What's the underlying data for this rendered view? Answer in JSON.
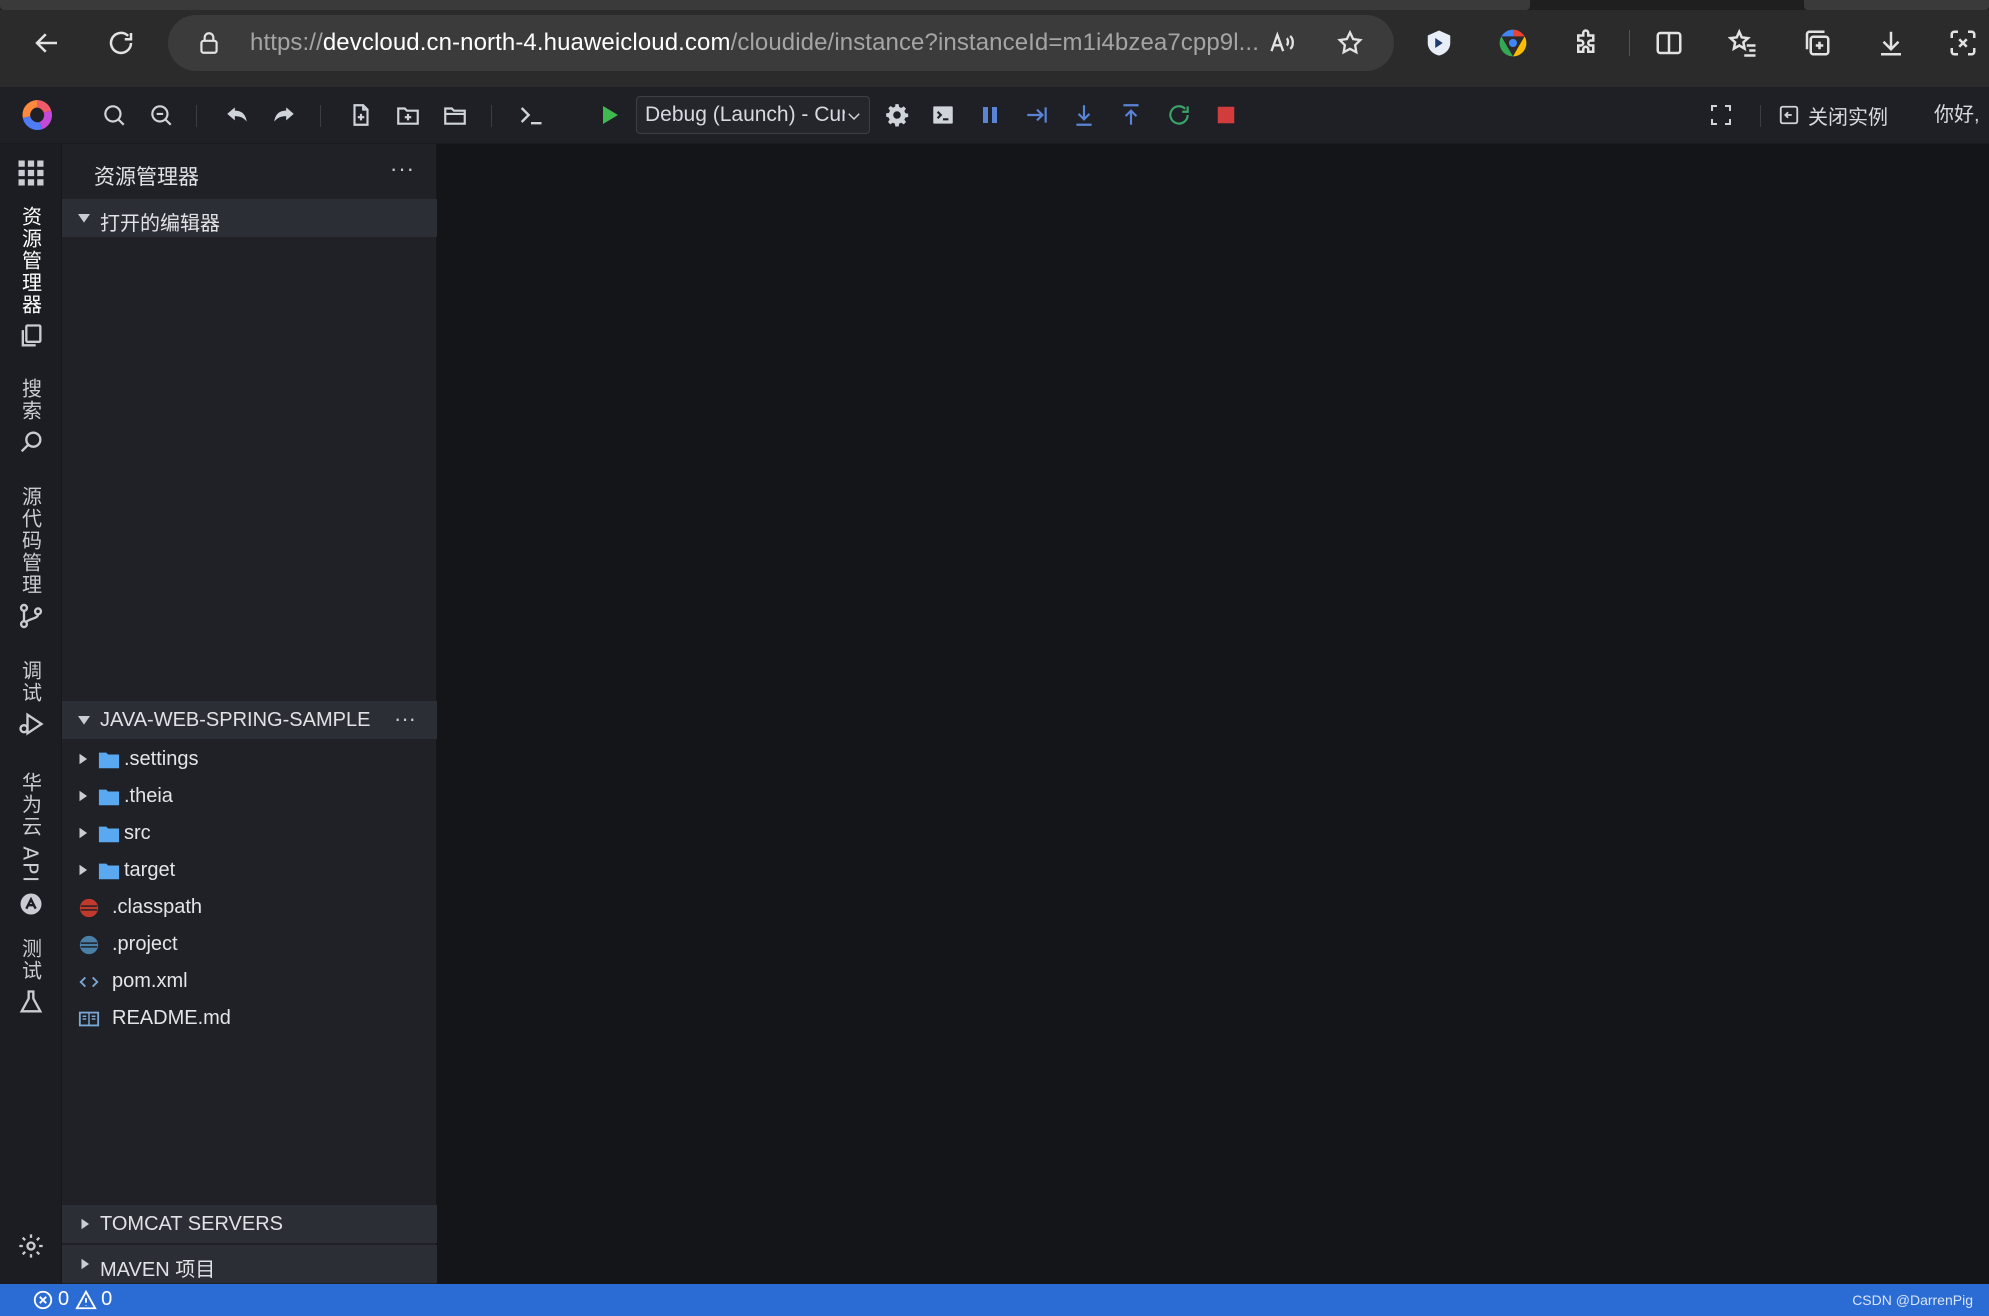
{
  "browser": {
    "url_prefix": "https://",
    "url_host": "devcloud.cn-north-4.huaweicloud.com",
    "url_path": "/cloudide/instance?instanceId=m1i4bzea7cpp9l..."
  },
  "toolbar": {
    "debug_config": "Debug (Launch) - Curr",
    "close_instance_label": "关闭实例",
    "greeting": "你好, "
  },
  "activity_bar": {
    "items": [
      {
        "label": "资源管理器",
        "icon": "files-icon"
      },
      {
        "label": "搜索",
        "icon": "search-icon"
      },
      {
        "label": "源代码管理",
        "icon": "source-control-icon"
      },
      {
        "label": "调试",
        "icon": "debug-icon"
      },
      {
        "label": "华为云 API",
        "icon": "api-icon"
      },
      {
        "label": "测试",
        "icon": "flask-icon"
      }
    ]
  },
  "explorer": {
    "title": "资源管理器",
    "more": "···",
    "open_editors": "打开的编辑器",
    "project": "JAVA-WEB-SPRING-SAMPLE",
    "items": [
      {
        "name": ".settings",
        "type": "folder"
      },
      {
        "name": ".theia",
        "type": "folder"
      },
      {
        "name": "src",
        "type": "folder"
      },
      {
        "name": "target",
        "type": "folder"
      },
      {
        "name": ".classpath",
        "type": "file"
      },
      {
        "name": ".project",
        "type": "file"
      },
      {
        "name": "pom.xml",
        "type": "file"
      },
      {
        "name": "README.md",
        "type": "file"
      }
    ],
    "tomcat": "TOMCAT SERVERS",
    "maven": "MAVEN 项目"
  },
  "status": {
    "errors": "0",
    "warnings": "0",
    "watermark": "CSDN @DarrenPig"
  },
  "colors": {
    "accent_status_bar": "#2b6cd4",
    "run_green": "#3fb950",
    "stop_red": "#d23c3c",
    "folder_blue": "#5aa8f0"
  }
}
